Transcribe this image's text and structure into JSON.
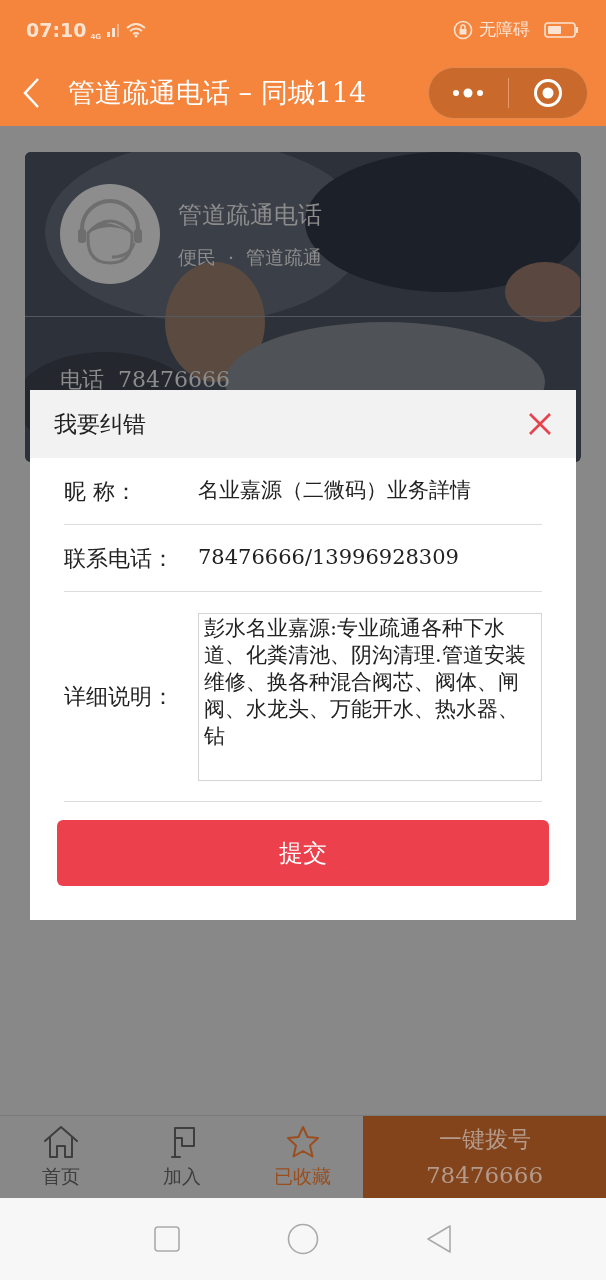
{
  "status_bar": {
    "time": "07:10",
    "network": "4G",
    "accessibility": "无障碍"
  },
  "nav_bar": {
    "title": "管道疏通电话 – 同城114"
  },
  "card": {
    "name": "管道疏通电话",
    "category": "便民",
    "separator": "·",
    "subcategory": "管道疏通",
    "phone_label": "电话",
    "phone": "78476666"
  },
  "dialog": {
    "title": "我要纠错",
    "fields": [
      {
        "kind": "input",
        "label": "昵 称：",
        "value": "名业嘉源（二微码）业务詳情"
      },
      {
        "kind": "input",
        "label": "联系电话：",
        "value": "78476666/13996928309"
      },
      {
        "kind": "textarea",
        "label": "详细说明：",
        "value": "彭水名业嘉源:专业疏通各种下水道、化粪清池、阴沟清理.管道安装维修、换各种混合阀芯、阀体、闸阀、水龙头、万能开水、热水器、钻"
      }
    ],
    "submit": "提交"
  },
  "tab_bar": {
    "items": [
      {
        "kind": "home",
        "label": "首页",
        "selected": false
      },
      {
        "kind": "flag",
        "label": "加入",
        "selected": false
      },
      {
        "kind": "star",
        "label": "已收藏",
        "selected": true
      }
    ],
    "call_button": {
      "label": "一键拨号",
      "number": "78476666"
    }
  }
}
